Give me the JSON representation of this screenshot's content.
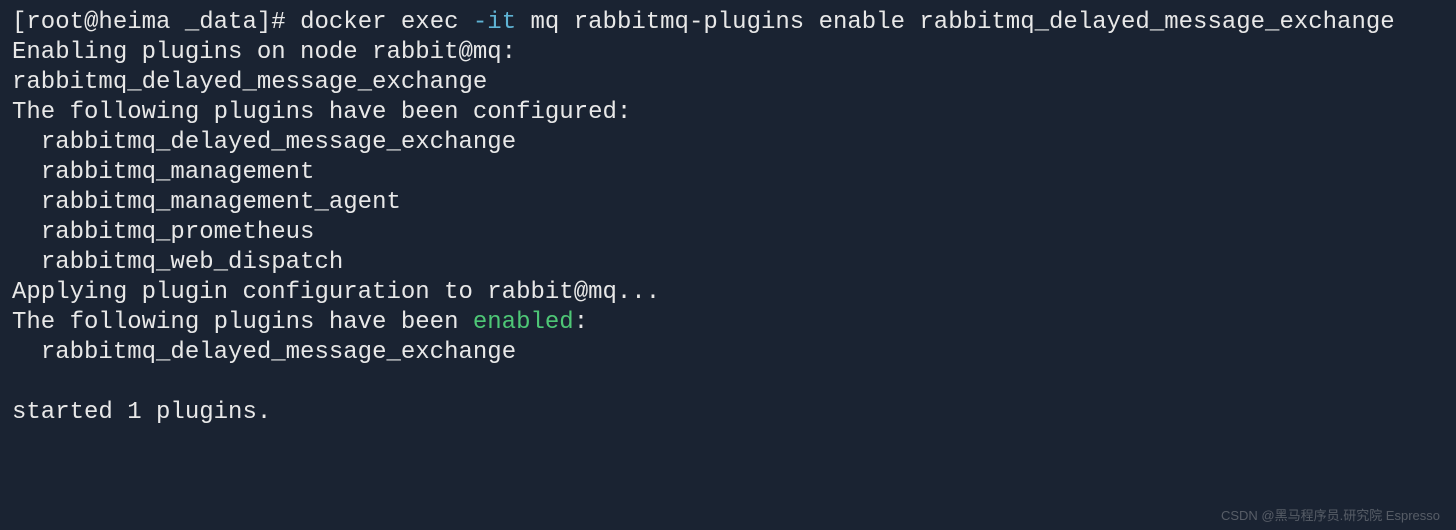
{
  "prompt": {
    "open_bracket": "[",
    "user_host": "root@heima",
    "space": " ",
    "cwd": "_data",
    "close_bracket": "]",
    "hash": "#"
  },
  "command": {
    "part1": "docker exec ",
    "flag": "-it",
    "part2": " mq rabbitmq-plugins enable rabbitmq_delayed_message_exchange"
  },
  "output": {
    "line1": "Enabling plugins on node rabbit@mq:",
    "line2": "rabbitmq_delayed_message_exchange",
    "line3": "The following plugins have been configured:",
    "configured_plugins": [
      "rabbitmq_delayed_message_exchange",
      "rabbitmq_management",
      "rabbitmq_management_agent",
      "rabbitmq_prometheus",
      "rabbitmq_web_dispatch"
    ],
    "line4": "Applying plugin configuration to rabbit@mq...",
    "line5_prefix": "The following plugins have been ",
    "line5_enabled": "enabled",
    "line5_suffix": ":",
    "enabled_plugins": [
      "rabbitmq_delayed_message_exchange"
    ],
    "line6": "started 1 plugins."
  },
  "watermark": "CSDN @黑马程序员.研究院 Espresso"
}
